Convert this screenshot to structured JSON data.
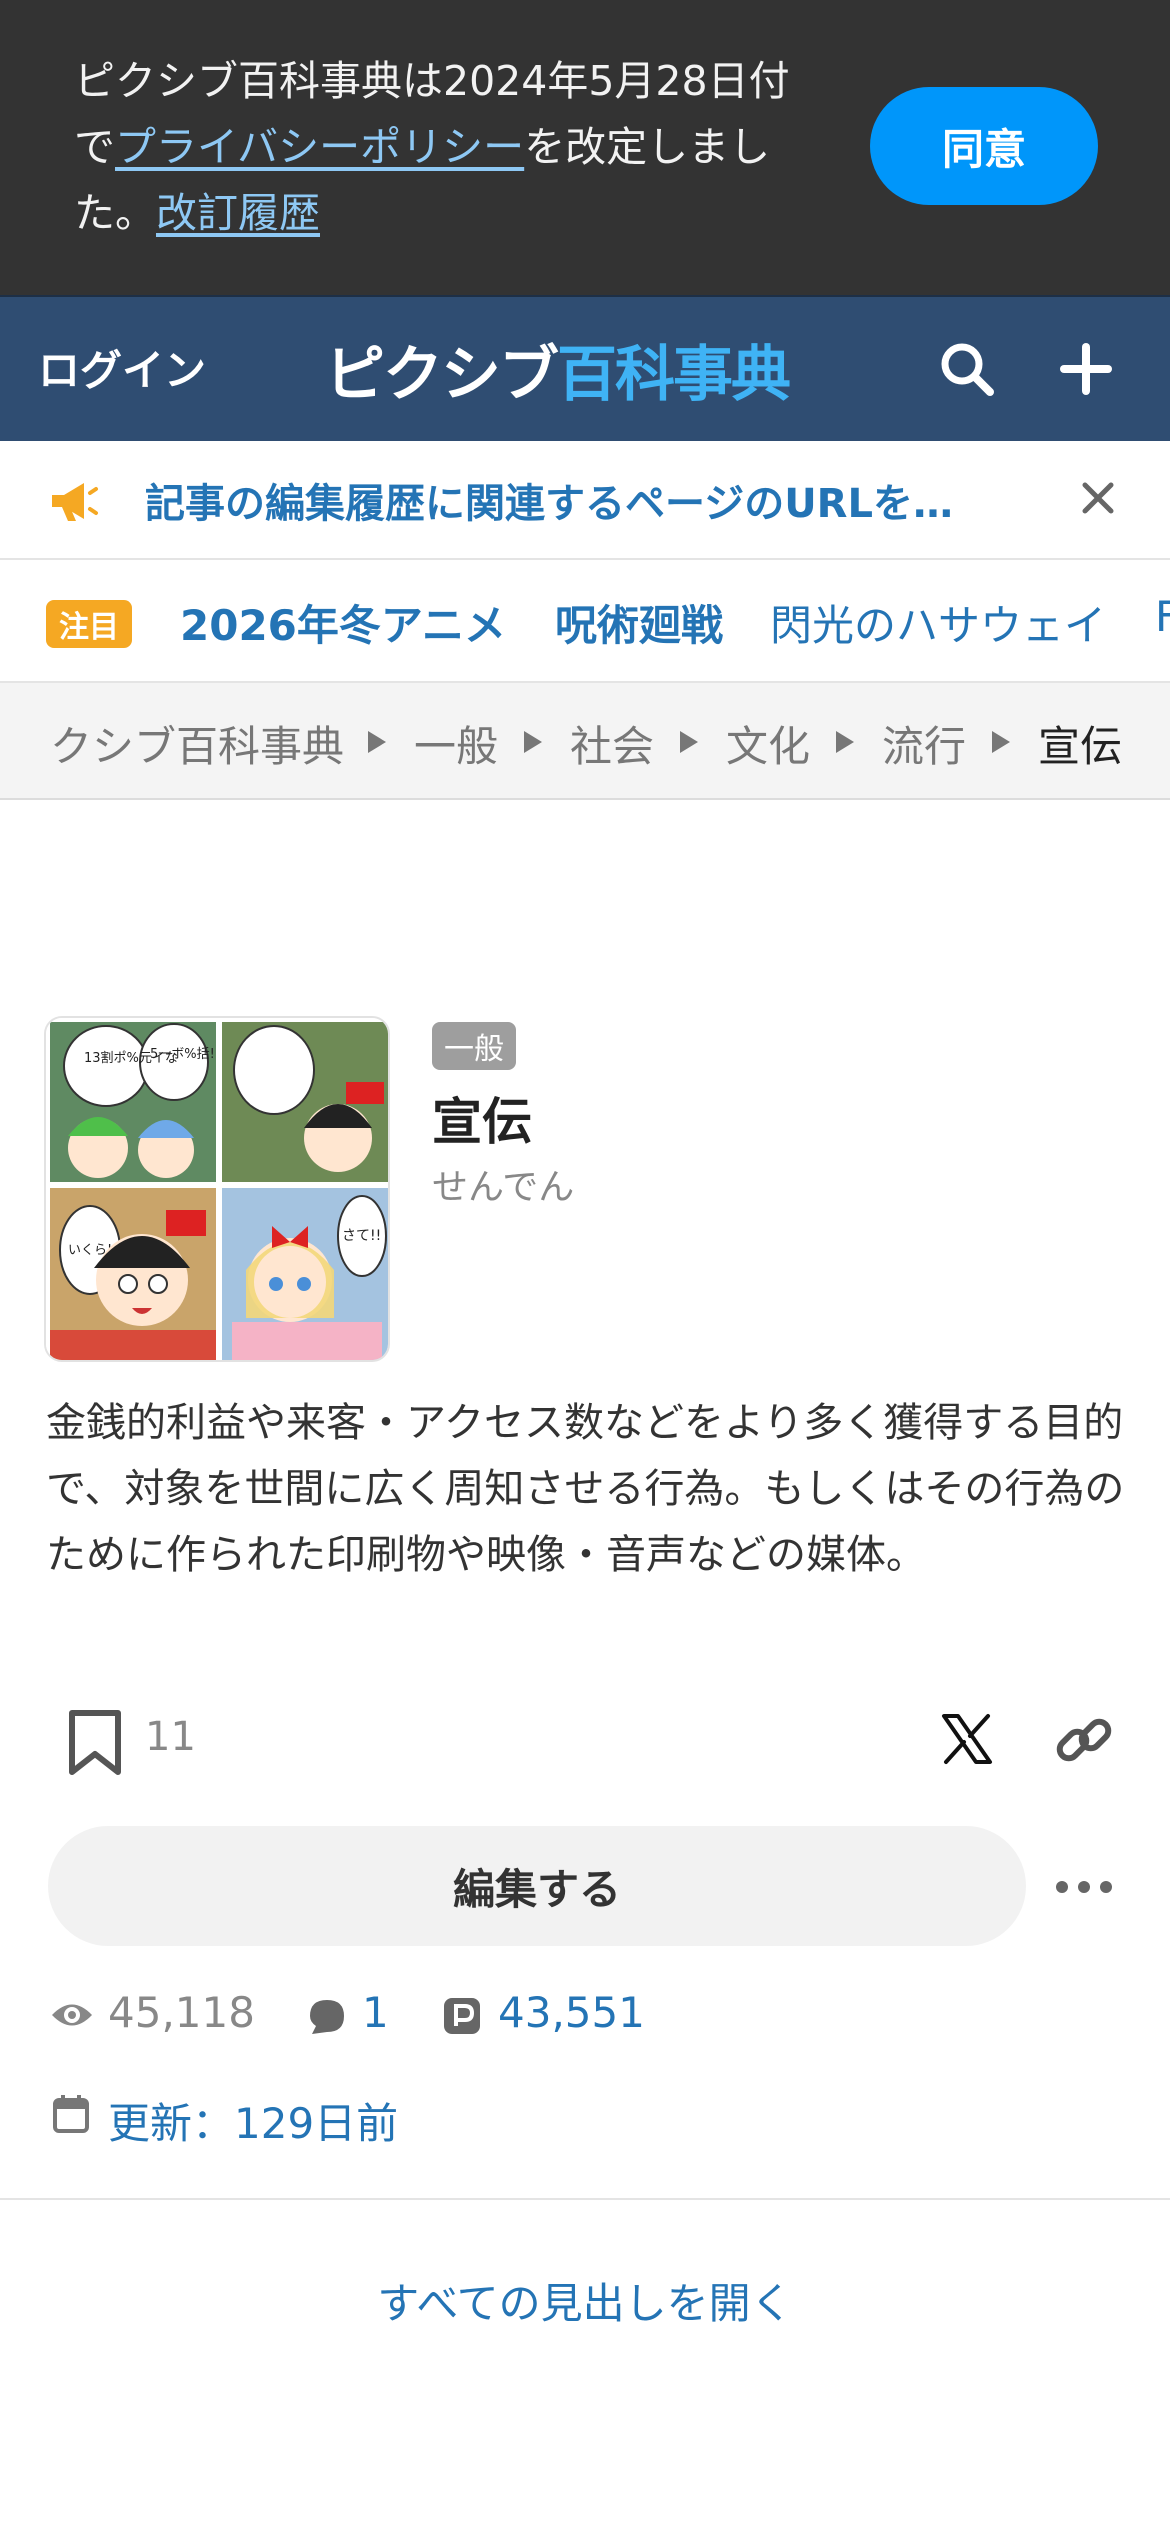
{
  "privacy_banner": {
    "text_part1": "ピクシブ百科事典は2024年5月28日付で",
    "policy_link": "プライバシーポリシー",
    "text_part2": "を改定しました。",
    "history_link": "改訂履歴",
    "agree_label": "同意"
  },
  "header": {
    "login_label": "ログイン",
    "logo_part1": "ピクシブ",
    "logo_part2": "百科事典",
    "search_icon": "search-icon",
    "add_icon": "plus-icon"
  },
  "notice": {
    "icon": "megaphone-icon",
    "text": "記事の編集履歴に関連するページのURLを…",
    "close_icon": "close-icon"
  },
  "trending": {
    "badge": "注目",
    "items": [
      {
        "label": "2026年冬アニメ"
      },
      {
        "label": "呪術廻戦"
      },
      {
        "label": "閃光のハサウェイ"
      },
      {
        "label": "F"
      }
    ]
  },
  "breadcrumb": {
    "items": [
      "クシブ百科事典",
      "一般",
      "社会",
      "文化",
      "流行",
      "宣伝"
    ]
  },
  "article": {
    "category": "一般",
    "title": "宣伝",
    "reading": "せんでん",
    "summary": "金銭的利益や来客・アクセス数などをより多く獲得する目的で、対象を世間に広く周知させる行為。もしくはその行為のために作られた印刷物や映像・音声などの媒体。",
    "thumb_texts": [
      "13割ポ%元イな",
      "5一ボ%括!",
      "いくら!?",
      "さて!!"
    ]
  },
  "actions": {
    "bookmark_count": "11",
    "edit_label": "編集する",
    "share_icon": "x-logo-icon",
    "link_icon": "link-icon",
    "more_icon": "more-icon"
  },
  "stats": {
    "views": "45,118",
    "comments": "1",
    "pixiv_works": "43,551",
    "updated": "更新：129日前"
  },
  "open_all_label": "すべての見出しを開く",
  "colors": {
    "banner_bg": "#333333",
    "agree_button": "#0096fa",
    "header_bg": "#2f4d72",
    "link": "#2474b5",
    "badge": "#f5a823"
  }
}
